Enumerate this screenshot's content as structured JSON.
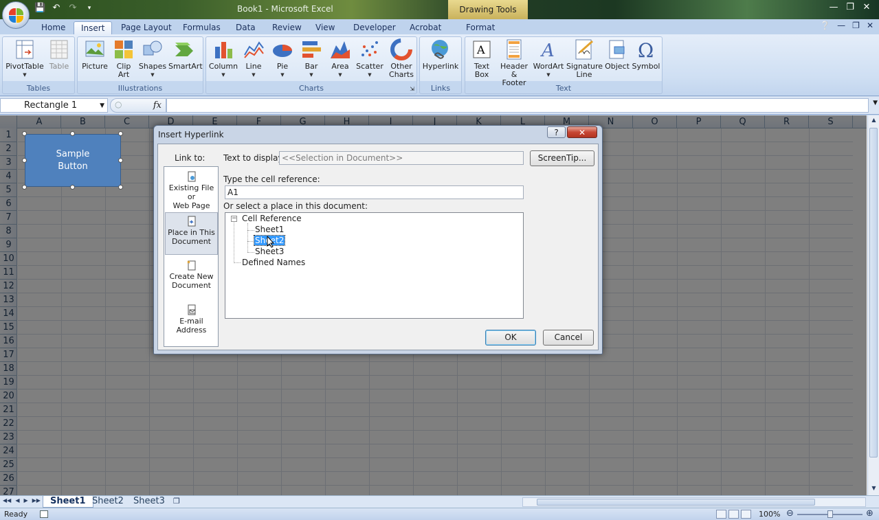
{
  "window": {
    "title": "Book1 - Microsoft Excel",
    "contextual_tab_group": "Drawing Tools"
  },
  "ribbon_tabs": [
    "Home",
    "Insert",
    "Page Layout",
    "Formulas",
    "Data",
    "Review",
    "View",
    "Developer",
    "Acrobat",
    "Format"
  ],
  "active_tab": "Insert",
  "ribbon": {
    "tables": {
      "label": "Tables",
      "buttons": [
        "PivotTable",
        "Table"
      ]
    },
    "illustrations": {
      "label": "Illustrations",
      "buttons": [
        "Picture",
        "Clip Art",
        "Shapes",
        "SmartArt"
      ]
    },
    "charts": {
      "label": "Charts",
      "buttons": [
        "Column",
        "Line",
        "Pie",
        "Bar",
        "Area",
        "Scatter",
        "Other Charts"
      ]
    },
    "links": {
      "label": "Links",
      "buttons": [
        "Hyperlink"
      ]
    },
    "text": {
      "label": "Text",
      "buttons": [
        "Text Box",
        "Header & Footer",
        "WordArt",
        "Signature Line",
        "Object",
        "Symbol"
      ]
    }
  },
  "formula_bar": {
    "name_box": "Rectangle 1",
    "fx": "fx",
    "value": ""
  },
  "columns": [
    "A",
    "B",
    "C",
    "D",
    "E",
    "F",
    "G",
    "H",
    "I",
    "J",
    "K",
    "L",
    "M",
    "N",
    "O",
    "P",
    "Q",
    "R",
    "S"
  ],
  "rows": [
    "1",
    "2",
    "3",
    "4",
    "5",
    "6",
    "7",
    "8",
    "9",
    "10",
    "11",
    "12",
    "13",
    "14",
    "15",
    "16",
    "17",
    "18",
    "19",
    "20",
    "21",
    "22",
    "23",
    "24",
    "25",
    "26",
    "27"
  ],
  "shape": {
    "line1": "Sample",
    "line2": "Button"
  },
  "sheet_tabs": [
    "Sheet1",
    "Sheet2",
    "Sheet3"
  ],
  "active_sheet": "Sheet1",
  "status": {
    "ready": "Ready",
    "zoom": "100%"
  },
  "dialog": {
    "title": "Insert Hyperlink",
    "help": "?",
    "close": "✕",
    "link_to_label": "Link to:",
    "link_to_items": [
      {
        "line1": "Existing File or",
        "line2": "Web Page"
      },
      {
        "line1": "Place in This",
        "line2": "Document"
      },
      {
        "line1": "Create New",
        "line2": "Document"
      },
      {
        "line1": "E-mail Address",
        "line2": ""
      }
    ],
    "active_link_to": 1,
    "text_to_display_label": "Text to display:",
    "text_to_display_value": "<<Selection in Document>>",
    "screentip_button": "ScreenTip...",
    "cell_ref_label": "Type the cell reference:",
    "cell_ref_value": "A1",
    "place_label": "Or select a place in this document:",
    "tree": {
      "root": "Cell Reference",
      "children": [
        "Sheet1",
        "Sheet2",
        "Sheet3"
      ],
      "selected_child": 1,
      "second_root": "Defined Names"
    },
    "ok_button": "OK",
    "cancel_button": "Cancel"
  }
}
